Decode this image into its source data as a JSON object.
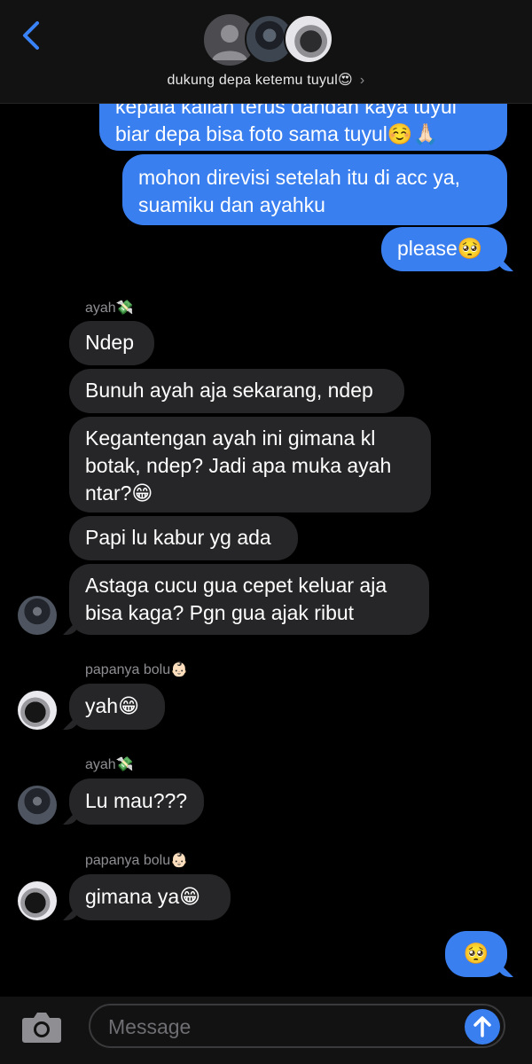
{
  "header": {
    "back_icon": "chevron-left-icon",
    "group_name": "dukung depa ketemu tuyul😍",
    "chevron": "›"
  },
  "messages": {
    "m1": "kepala kalian terus dandan kaya tuyul\nbiar depa bisa foto sama tuyul☺️🙏🏻",
    "m2": "mohon direvisi setelah itu di acc ya,\nsuamiku dan ayahku",
    "m3": "please🥺",
    "s1": "ayah💸",
    "r1": "Ndep",
    "r2": "Bunuh ayah aja sekarang, ndep",
    "r3": "Kegantengan ayah ini gimana kl\nbotak, ndep? Jadi apa muka ayah\nntar?😁",
    "r4": "Papi lu kabur yg ada",
    "r5": "Astaga cucu gua cepet keluar aja\nbisa kaga? Pgn gua ajak ribut",
    "s2": "papanya bolu👶🏻",
    "r6": "yah😁",
    "s3": "ayah💸",
    "r7": "Lu mau???",
    "s4": "papanya bolu👶🏻",
    "r8": "gimana ya😁",
    "m4": "🥺"
  },
  "input": {
    "placeholder": "Message",
    "camera_icon": "camera-icon",
    "send_icon": "arrow-up-icon"
  },
  "colors": {
    "sent": "#3a7ff0",
    "received": "#262628",
    "background": "#000000"
  }
}
